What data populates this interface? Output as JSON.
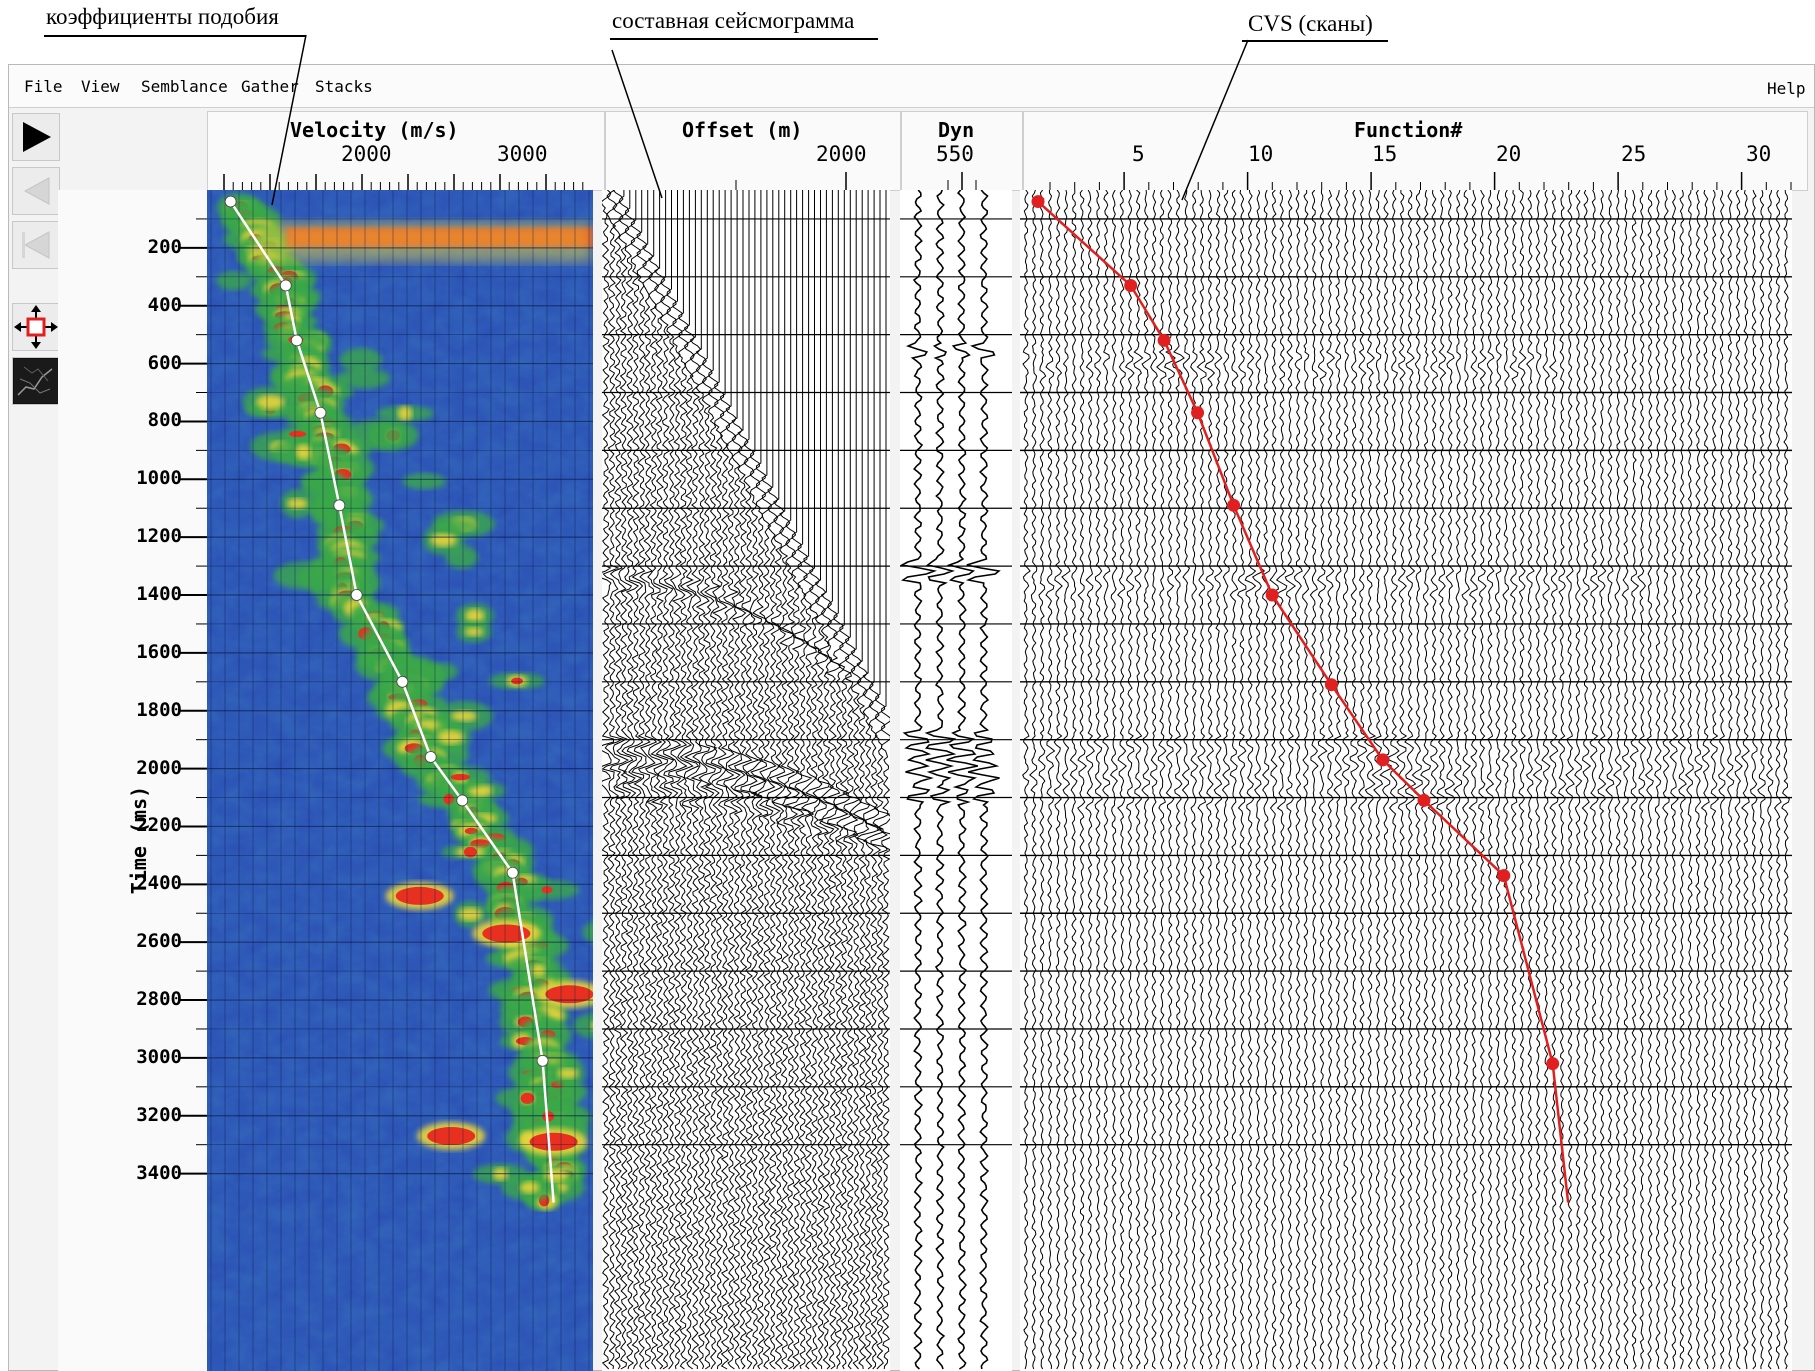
{
  "annotations": {
    "semblance": "коэффициенты подобия",
    "gather": "составная сейсмограмма",
    "cvs": "CVS (сканы)"
  },
  "menu": {
    "items": [
      "File",
      "View",
      "Semblance",
      "Gather",
      "Stacks"
    ],
    "help": "Help"
  },
  "toolbar": {
    "tools": [
      "play-icon",
      "step-back-icon",
      "rewind-icon",
      "move-icon",
      "thumbnail-icon"
    ]
  },
  "velocity_panel": {
    "title": "Velocity (m/s)",
    "ticks": [
      "2000",
      "3000"
    ]
  },
  "offset_panel": {
    "title": "Offset (m)",
    "ticks": [
      "2000"
    ]
  },
  "dyn_panel": {
    "title": "Dyn",
    "ticks": [
      "550"
    ]
  },
  "function_panel": {
    "title": "Function#",
    "ticks": [
      "5",
      "10",
      "15",
      "20",
      "25",
      "30"
    ]
  },
  "time_axis": {
    "label": "Time (ms)",
    "ticks": [
      "200",
      "400",
      "600",
      "800",
      "1000",
      "1200",
      "1400",
      "1600",
      "1800",
      "2000",
      "2200",
      "2400",
      "2600",
      "2800",
      "3000",
      "3200",
      "3400"
    ]
  },
  "colors": {
    "velocity_pick": "#ffffff",
    "function_pick": "#e02020",
    "semblance_background": "#2b4fb5",
    "semblance_high": "#e83020"
  },
  "chart_data": [
    {
      "type": "line",
      "title": "Velocity (m/s)",
      "xlabel": "Velocity (m/s)",
      "ylabel": "Time (ms)",
      "xlim": [
        1000,
        3450
      ],
      "ylim": [
        3500,
        0
      ],
      "grid": true,
      "series": [
        {
          "x": [
            1150,
            1500,
            1570,
            1720,
            1840,
            1950,
            2240,
            2420,
            2620,
            2940,
            3130,
            3200
          ],
          "y": [
            40,
            330,
            520,
            770,
            1090,
            1400,
            1700,
            1960,
            2110,
            2360,
            3010,
            3500
          ]
        }
      ]
    },
    {
      "type": "line",
      "title": "Function#",
      "xlabel": "Function#",
      "ylabel": "Time (ms)",
      "xlim": [
        1.5,
        31.5
      ],
      "ylim": [
        3500,
        0
      ],
      "grid": true,
      "series": [
        {
          "x": [
            2.2,
            5.8,
            7.1,
            8.4,
            9.8,
            11.3,
            13.6,
            15.6,
            17.2,
            20.3,
            22.2,
            22.8
          ],
          "y": [
            40,
            330,
            520,
            770,
            1090,
            1400,
            1710,
            1970,
            2110,
            2370,
            3020,
            3500
          ]
        }
      ]
    }
  ]
}
